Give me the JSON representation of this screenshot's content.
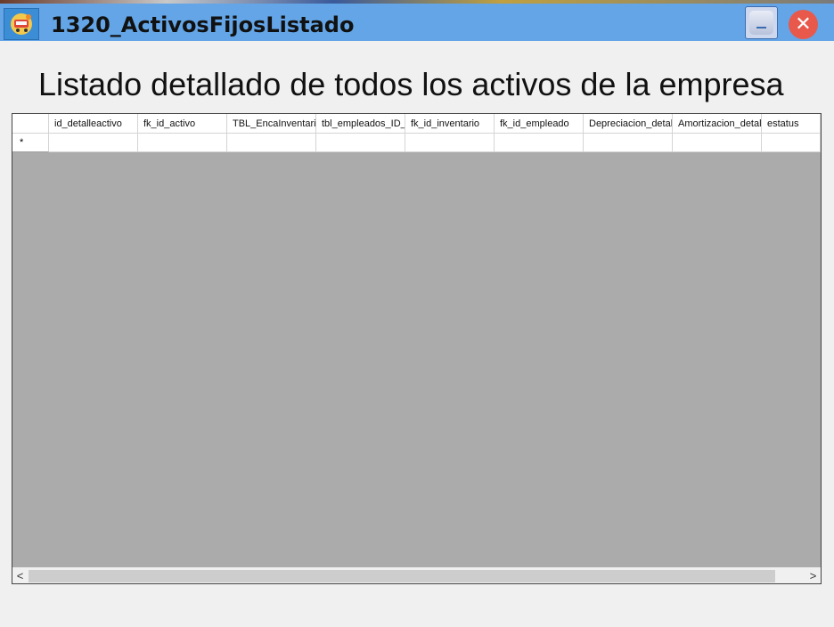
{
  "window": {
    "title": "1320_ActivosFijosListado",
    "close_glyph": "✕"
  },
  "heading": "Listado detallado de todos los activos de la empresa",
  "grid": {
    "columns": [
      "id_detalleactivo",
      "fk_id_activo",
      "TBL_EncaInventari",
      "tbl_empleados_ID_",
      "fk_id_inventario",
      "fk_id_empleado",
      "Depreciacion_detal",
      "Amortizacion_detall",
      "estatus"
    ],
    "new_row_marker": "*"
  },
  "scrollbar": {
    "left_arrow": "<",
    "right_arrow": ">"
  },
  "icons": {
    "app": "app-cart-icon",
    "minimize": "minimize-icon",
    "close": "close-icon"
  },
  "colors": {
    "titlebar": "#63a5e6",
    "close": "#e8594c",
    "grid_background": "#ababab"
  }
}
